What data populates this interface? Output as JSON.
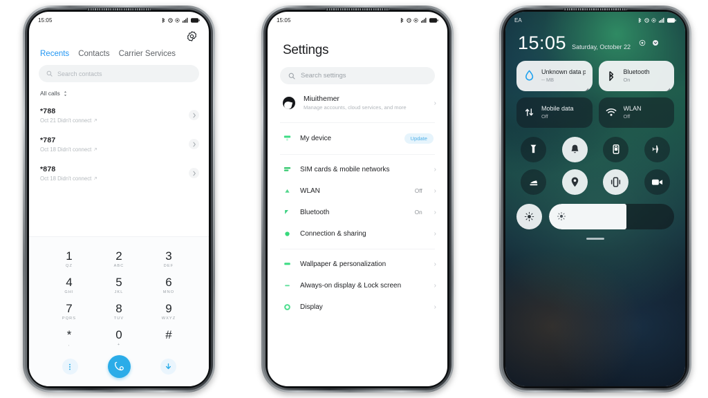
{
  "phone1": {
    "name": "dialer-app",
    "statusbar": {
      "time": "15:05",
      "icons": [
        "bluetooth-icon",
        "alarm-icon",
        "dnd-icon",
        "signal-icon",
        "battery-icon"
      ]
    },
    "gear_icon": "gear-icon",
    "tabs": [
      {
        "label": "Recents",
        "active": true
      },
      {
        "label": "Contacts",
        "active": false
      },
      {
        "label": "Carrier Services",
        "active": false
      }
    ],
    "search": {
      "placeholder": "Search contacts",
      "icon": "search-icon"
    },
    "filter": {
      "label": "All calls",
      "icon": "sort-icon"
    },
    "calls": [
      {
        "number": "*788",
        "detail": "Oct 21 Didn't connect"
      },
      {
        "number": "*787",
        "detail": "Oct 18 Didn't connect"
      },
      {
        "number": "*878",
        "detail": "Oct 18 Didn't connect"
      }
    ],
    "keypad": [
      {
        "digit": "1",
        "sub": "QZ"
      },
      {
        "digit": "2",
        "sub": "ABC"
      },
      {
        "digit": "3",
        "sub": "DEF"
      },
      {
        "digit": "4",
        "sub": "GHI"
      },
      {
        "digit": "5",
        "sub": "JKL"
      },
      {
        "digit": "6",
        "sub": "MNO"
      },
      {
        "digit": "7",
        "sub": "PQRS"
      },
      {
        "digit": "8",
        "sub": "TUV"
      },
      {
        "digit": "9",
        "sub": "WXYZ"
      },
      {
        "digit": "*",
        "sub": ","
      },
      {
        "digit": "0",
        "sub": "+"
      },
      {
        "digit": "#",
        "sub": ""
      }
    ],
    "actions": {
      "menu_icon": "more-vertical-icon",
      "call_icon": "call-icon",
      "hide_icon": "arrow-down-icon",
      "accent_color": "#2bace8"
    }
  },
  "phone2": {
    "name": "settings-app",
    "statusbar": {
      "time": "15:05"
    },
    "title": "Settings",
    "search": {
      "placeholder": "Search settings",
      "icon": "search-icon"
    },
    "account": {
      "name": "Miuithemer",
      "subtitle": "Manage accounts, cloud services, and more",
      "avatar": "avatar"
    },
    "groups": [
      {
        "items": [
          {
            "label": "My device",
            "badge": "Update",
            "value": "",
            "icon": "device-icon",
            "color": "#3ddc84"
          }
        ]
      },
      {
        "items": [
          {
            "label": "SIM cards & mobile networks",
            "value": "",
            "badge": "",
            "icon": "sim-icon",
            "color": "#35c96f"
          },
          {
            "label": "WLAN",
            "value": "Off",
            "badge": "",
            "icon": "wifi-icon",
            "color": "#52d68c"
          },
          {
            "label": "Bluetooth",
            "value": "On",
            "badge": "",
            "icon": "bluetooth-icon",
            "color": "#3fd183"
          },
          {
            "label": "Connection & sharing",
            "value": "",
            "badge": "",
            "icon": "share-icon",
            "color": "#38d97c"
          }
        ]
      },
      {
        "items": [
          {
            "label": "Wallpaper & personalization",
            "value": "",
            "badge": "",
            "icon": "wallpaper-icon",
            "color": "#3ddc84"
          },
          {
            "label": "Always-on display & Lock screen",
            "value": "",
            "badge": "",
            "icon": "lockscreen-icon",
            "color": "#5fdf9a"
          },
          {
            "label": "Display",
            "value": "",
            "badge": "",
            "icon": "display-icon",
            "color": "#4ede8f"
          }
        ]
      }
    ],
    "chevron": "›"
  },
  "phone3": {
    "name": "control-center",
    "carrier": "EA",
    "statusbar": {
      "icons": [
        "bluetooth-icon",
        "alarm-icon",
        "dnd-icon",
        "signal-icon",
        "battery-icon"
      ]
    },
    "time": "15:05",
    "date": "Saturday, October 22",
    "header_icons": [
      "settings-icon",
      "chevron-down-icon"
    ],
    "tiles": [
      {
        "title": "Unknown data plan",
        "subtitle": "-- MB",
        "state": "on",
        "icon": "data-drop-icon"
      },
      {
        "title": "Bluetooth",
        "subtitle": "On",
        "state": "on",
        "icon": "bluetooth-icon"
      },
      {
        "title": "Mobile data",
        "subtitle": "Off",
        "state": "off",
        "icon": "mobile-data-icon"
      },
      {
        "title": "WLAN",
        "subtitle": "Off",
        "state": "off",
        "icon": "wifi-icon"
      }
    ],
    "toggles": [
      {
        "name": "flashlight",
        "state": "off",
        "icon": "flashlight-icon"
      },
      {
        "name": "silent",
        "state": "on",
        "icon": "bell-mute-icon"
      },
      {
        "name": "rotation-lock",
        "state": "off",
        "icon": "rotation-lock-icon"
      },
      {
        "name": "airplane-mode",
        "state": "off",
        "icon": "airplane-icon"
      },
      {
        "name": "cast",
        "state": "off",
        "icon": "cast-icon"
      },
      {
        "name": "location",
        "state": "on",
        "icon": "location-icon"
      },
      {
        "name": "vibrate",
        "state": "on",
        "icon": "vibrate-icon"
      },
      {
        "name": "screen-record",
        "state": "off",
        "icon": "video-icon"
      }
    ],
    "brightness": {
      "auto_icon": "brightness-auto-icon",
      "slider_icon": "brightness-icon",
      "level": 62
    }
  }
}
